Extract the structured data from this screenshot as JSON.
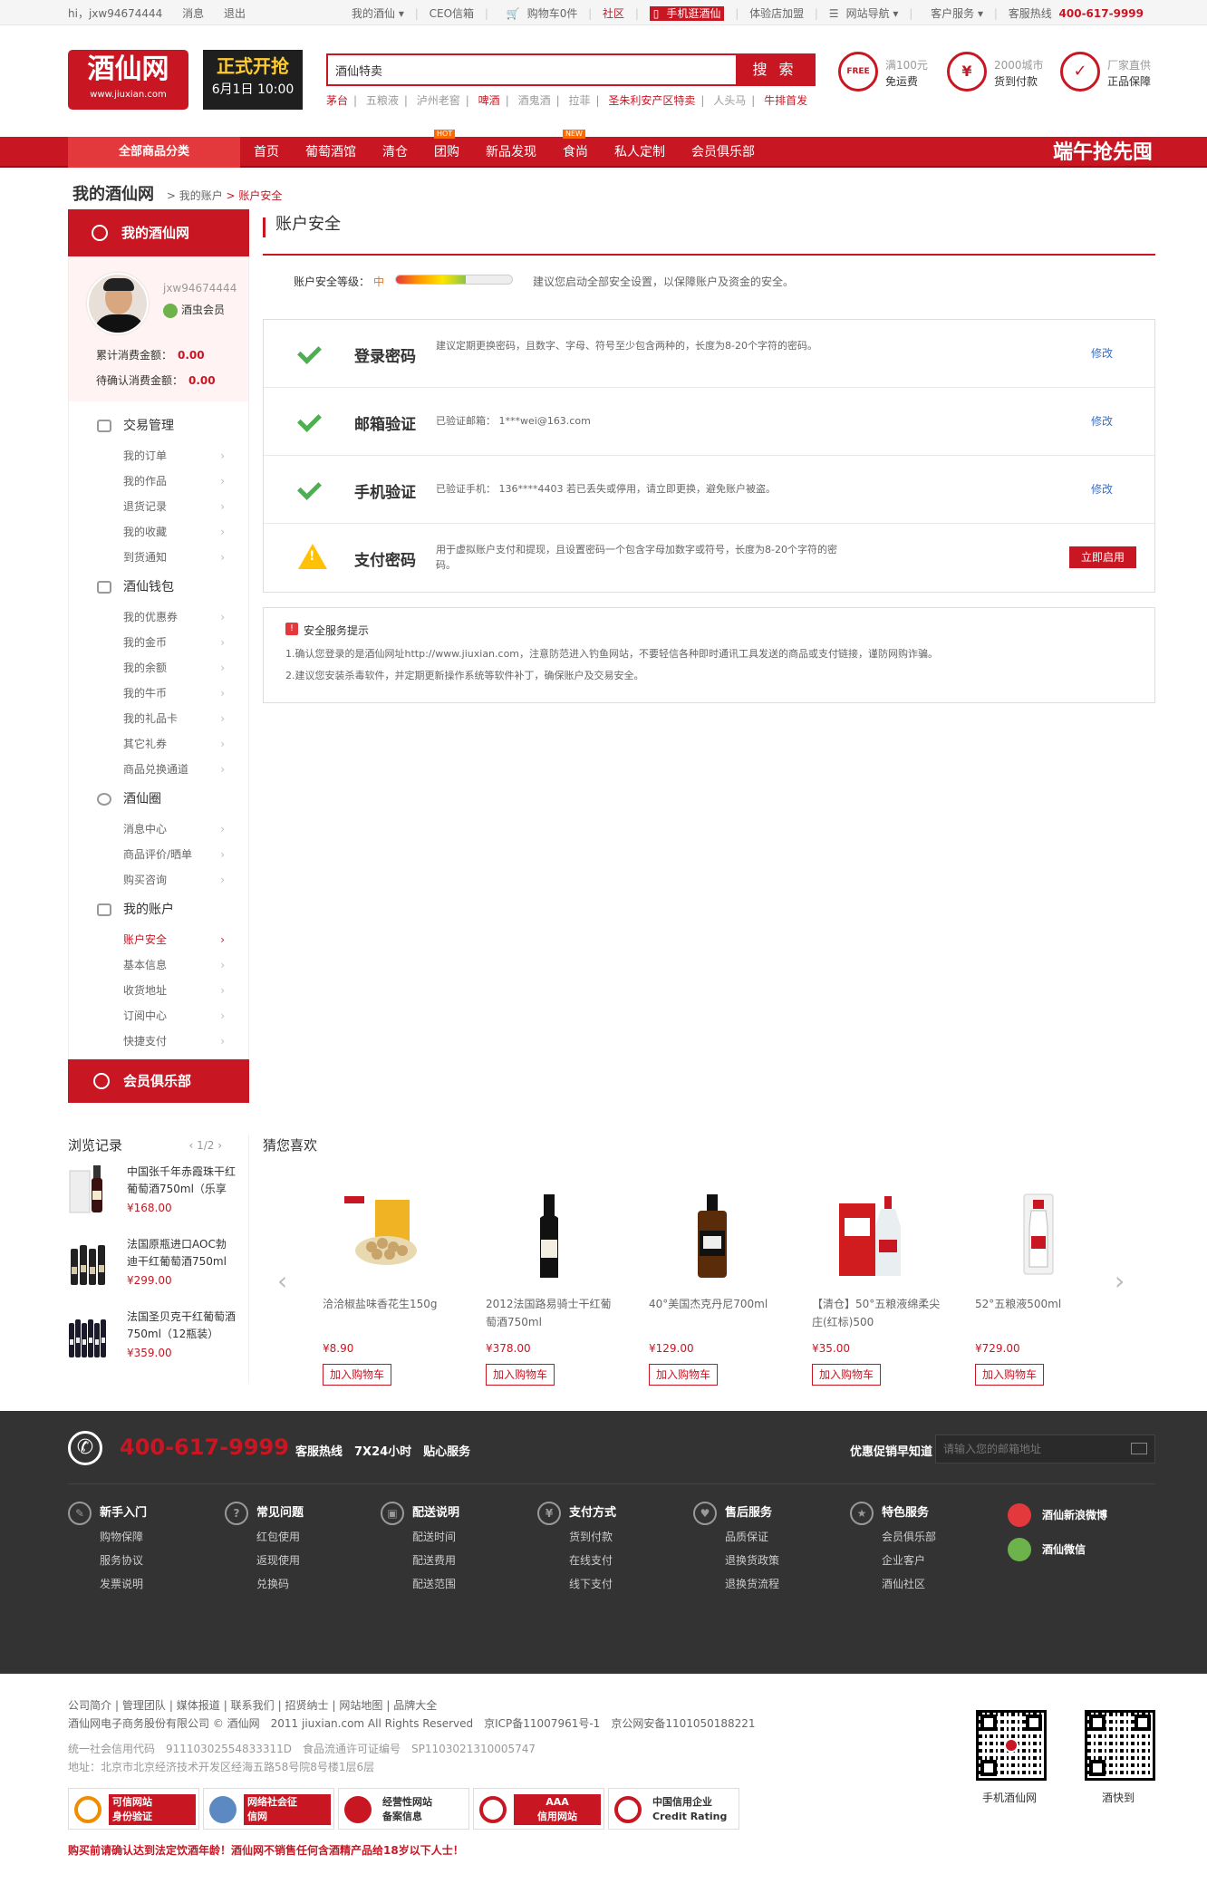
{
  "topbar": {
    "greeting": "hi，jxw94674444",
    "messages": "消息",
    "logout": "退出",
    "my_jiuxian": "我的酒仙",
    "ceo_mailbox": "CEO信箱",
    "cart": "购物车0件",
    "community": "社区",
    "mobile": "手机逛酒仙",
    "store_join": "体验店加盟",
    "site_nav": "网站导航",
    "customer_service": "客户服务",
    "hotline_label": "客服热线",
    "hotline": "400-617-9999"
  },
  "header": {
    "logo_text": "酒仙网",
    "logo_url": "www.jiuxian.com",
    "promo_title": "正式开抢",
    "promo_date": "6月1日 10:00",
    "search_value": "酒仙特卖",
    "search_button": "搜 索",
    "hot_words": [
      "茅台",
      "五粮液",
      "泸州老窖",
      "啤酒",
      "酒鬼酒",
      "拉菲",
      "圣朱利安产区特卖",
      "人头马",
      "牛排首发"
    ],
    "services": [
      {
        "icon": "FREE",
        "line1": "满100元",
        "line2": "免运费"
      },
      {
        "icon": "¥",
        "line1": "2000城市",
        "line2": "货到付款"
      },
      {
        "icon": "✓",
        "line1": "厂家直供",
        "line2": "正品保障"
      }
    ]
  },
  "nav": {
    "all_categories": "全部商品分类",
    "items": [
      {
        "label": "首页",
        "badge": ""
      },
      {
        "label": "葡萄酒馆",
        "badge": ""
      },
      {
        "label": "清仓",
        "badge": ""
      },
      {
        "label": "团购",
        "badge": "HOT"
      },
      {
        "label": "新品发现",
        "badge": ""
      },
      {
        "label": "食尚",
        "badge": "NEW"
      },
      {
        "label": "私人定制",
        "badge": ""
      },
      {
        "label": "会员俱乐部",
        "badge": ""
      }
    ],
    "slogan": "端午抢先囤"
  },
  "breadcrumb": {
    "home": "我的酒仙网",
    "level1": "> 我的账户",
    "level2": "> 账户安全"
  },
  "sidebar": {
    "head": "我的酒仙网",
    "username": "jxw94674444",
    "level": "酒虫会员",
    "total_consumed_label": "累计消费金额：",
    "total_consumed": "0.00",
    "pending_label": "待确认消费金额：",
    "pending": "0.00",
    "groups": [
      {
        "label": "交易管理",
        "items": [
          "我的订单",
          "我的作品",
          "退货记录",
          "我的收藏",
          "到货通知"
        ]
      },
      {
        "label": "酒仙钱包",
        "items": [
          "我的优惠券",
          "我的金币",
          "我的余额",
          "我的牛币",
          "我的礼品卡",
          "其它礼券",
          "商品兑换通道"
        ]
      },
      {
        "label": "酒仙圈",
        "items": [
          "消息中心",
          "商品评价/晒单",
          "购买咨询"
        ]
      },
      {
        "label": "我的账户",
        "items": [
          "账户安全",
          "基本信息",
          "收货地址",
          "订阅中心",
          "快捷支付"
        ]
      }
    ],
    "club": "会员俱乐部"
  },
  "main": {
    "title": "账户安全",
    "level_label": "账户安全等级：",
    "level_value": "中",
    "level_progress": 0.6,
    "level_tip": "建议您启动全部安全设置，以保障账户及资金的安全。",
    "rows": [
      {
        "status": "ok",
        "name": "登录密码",
        "desc": "建议定期更换密码，且数字、字母、符号至少包含两种的，长度为8-20个字符的密码。",
        "action": "修改"
      },
      {
        "status": "ok",
        "name": "邮箱验证",
        "desc": "已验证邮箱： 1***wei@163.com",
        "action": "修改"
      },
      {
        "status": "ok",
        "name": "手机验证",
        "desc": "已验证手机： 136****4403 若已丢失或停用，请立即更换，避免账户被盗。",
        "action": "修改"
      },
      {
        "status": "warn",
        "name": "支付密码",
        "desc": "用于虚拟账户支付和提现，且设置密码一个包含字母加数字或符号，长度为8-20个字符的密码。",
        "action": "立即启用"
      }
    ],
    "tips_title": "安全服务提示",
    "tips": [
      "1.确认您登录的是酒仙网址http://www.jiuxian.com，注意防范进入钓鱼网站，不要轻信各种即时通讯工具发送的商品或支付链接，谨防网购诈骗。",
      "2.建议您安装杀毒软件，并定期更新操作系统等软件补丁，确保账户及交易安全。"
    ]
  },
  "browse": {
    "title": "浏览记录",
    "page": "1/2",
    "items": [
      {
        "name": "中国张千年赤霞珠干红葡萄酒750ml（乐享",
        "price": "¥168.00"
      },
      {
        "name": "法国原瓶进口AOC勃迪干红葡萄酒750ml",
        "price": "¥299.00"
      },
      {
        "name": "法国圣贝克干红葡萄酒750ml（12瓶装）",
        "price": "¥359.00"
      }
    ]
  },
  "guess": {
    "title": "猜您喜欢",
    "items": [
      {
        "name": "洽洽椒盐味香花生150g",
        "price": "¥8.90",
        "cart": "加入购物车"
      },
      {
        "name": "2012法国路易骑士干红葡萄酒750ml",
        "price": "¥378.00",
        "cart": "加入购物车"
      },
      {
        "name": "40°美国杰克丹尼700ml",
        "price": "¥129.00",
        "cart": "加入购物车"
      },
      {
        "name": "【清仓】50°五粮液绵柔尖庄(红标)500",
        "price": "¥35.00",
        "cart": "加入购物车"
      },
      {
        "name": "52°五粮液500ml",
        "price": "¥729.00",
        "cart": "加入购物车"
      }
    ]
  },
  "footer": {
    "tel": "400-617-9999",
    "service_text": "客服热线　7X24小时　贴心服务",
    "subscribe_label": "优惠促销早知道",
    "email_placeholder": "请输入您的邮箱地址",
    "columns": [
      {
        "icon": "✎",
        "title": "新手入门",
        "links": [
          "购物保障",
          "服务协议",
          "发票说明"
        ]
      },
      {
        "icon": "?",
        "title": "常见问题",
        "links": [
          "红包使用",
          "返现使用",
          "兑换码"
        ]
      },
      {
        "icon": "▣",
        "title": "配送说明",
        "links": [
          "配送时间",
          "配送费用",
          "配送范围"
        ]
      },
      {
        "icon": "¥",
        "title": "支付方式",
        "links": [
          "货到付款",
          "在线支付",
          "线下支付"
        ]
      },
      {
        "icon": "♥",
        "title": "售后服务",
        "links": [
          "品质保证",
          "退换货政策",
          "退换货流程"
        ]
      },
      {
        "icon": "★",
        "title": "特色服务",
        "links": [
          "会员俱乐部",
          "企业客户",
          "酒仙社区"
        ]
      }
    ],
    "weibo": "酒仙新浪微博",
    "wechat": "酒仙微信"
  },
  "bottom": {
    "links": [
      "公司简介",
      "管理团队",
      "媒体报道",
      "联系我们",
      "招贤纳士",
      "网站地图",
      "品牌大全"
    ],
    "copyright": "酒仙网电子商务股份有限公司 © 酒仙网　2011  jiuxian.com  All  Rights Reserved　京ICP备11007961号-1　京公网安备1101050188221",
    "credit_code": "统一社会信用代码　91110302554833311D　食品流通许可证编号　SP1103021310005747",
    "address": "地址：北京市北京经济技术开发区经海五路58号院8号楼1层6层",
    "badges": [
      {
        "line1": "可信网站",
        "line2": "身份验证",
        "color": "#c81623"
      },
      {
        "line1": "网络社会征",
        "line2": "信网",
        "color": "#c81623"
      },
      {
        "line1": "经营性网站",
        "line2": "备案信息",
        "color": "#c81623"
      },
      {
        "line1": "AAA",
        "line2": "信用网站",
        "color": "#c81623"
      },
      {
        "line1": "中国信用企业",
        "line2": "Credit Rating",
        "color": "#c81623"
      }
    ],
    "legal": "购买前请确认达到法定饮酒年龄！酒仙网不销售任何含酒精产品给18岁以下人士！",
    "qr1_label": "手机酒仙网",
    "qr2_label": "酒快到"
  }
}
